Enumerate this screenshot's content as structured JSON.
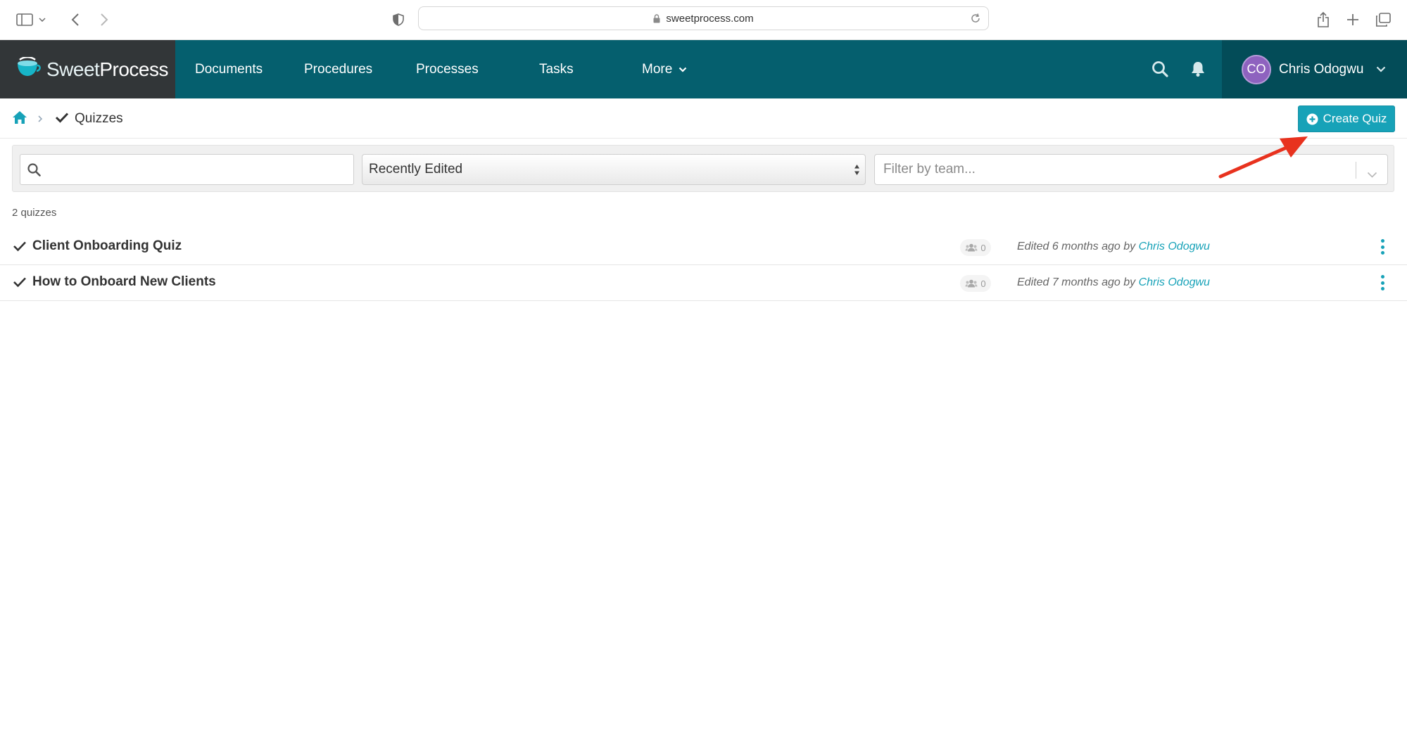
{
  "browser": {
    "url": "sweetprocess.com"
  },
  "nav": {
    "logo_prefix": "Sweet",
    "logo_suffix": "Process",
    "items": [
      "Documents",
      "Procedures",
      "Processes",
      "Tasks",
      "More"
    ],
    "user_initials": "CO",
    "user_name": "Chris Odogwu"
  },
  "breadcrumb": {
    "page_title": "Quizzes"
  },
  "toolbar": {
    "create_label": "Create Quiz"
  },
  "filters": {
    "search_placeholder": "",
    "sort_value": "Recently Edited",
    "team_placeholder": "Filter by team..."
  },
  "list": {
    "count_label": "2 quizzes",
    "rows": [
      {
        "title": "Client Onboarding Quiz",
        "members": "0",
        "edited_prefix": "Edited 6 months ago by ",
        "edited_by": "Chris Odogwu"
      },
      {
        "title": "How to Onboard New Clients",
        "members": "0",
        "edited_prefix": "Edited 7 months ago by ",
        "edited_by": "Chris Odogwu"
      }
    ]
  },
  "colors": {
    "nav_bg": "#055f6e",
    "logo_bg": "#323638",
    "accent": "#17a2b8",
    "avatar": "#8e62bf",
    "arrow": "#e8321e"
  }
}
